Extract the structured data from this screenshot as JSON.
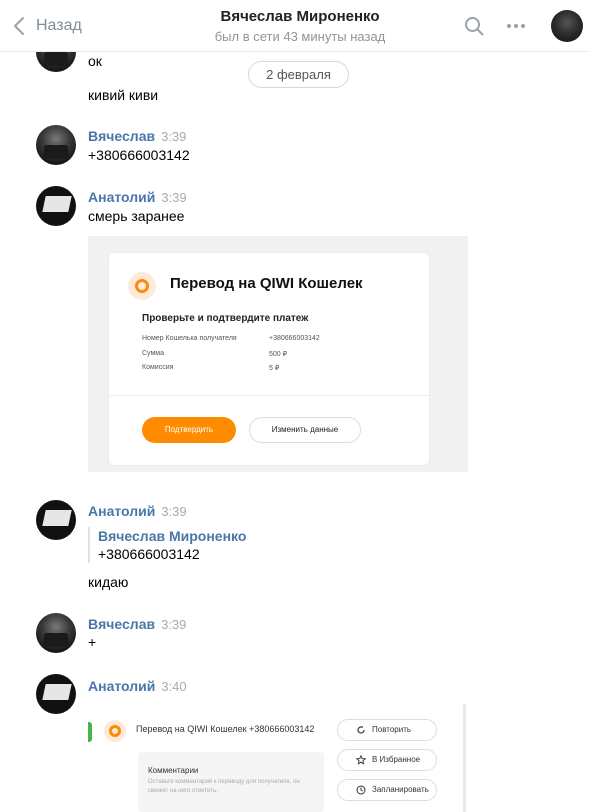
{
  "header": {
    "back_label": "Назад",
    "title": "Вячеслав Мироненко",
    "subtitle": "был в сети 43 минуты назад",
    "icons": [
      "chevron-left-icon",
      "search-icon",
      "more-icon"
    ]
  },
  "date_divider": "2 февраля",
  "messages": [
    {
      "text": "ок"
    },
    {
      "text": "кивий киви"
    },
    {
      "author": "Вячеслав",
      "time": "3:39",
      "text": "+380666003142"
    },
    {
      "author": "Анатолий",
      "time": "3:39",
      "text": "смерь заранее"
    },
    {
      "author": "Анатолий",
      "time": "3:39",
      "fwd_author": "Вячеслав Мироненко",
      "fwd_text": "+380666003142",
      "text": "кидаю"
    },
    {
      "author": "Вячеслав",
      "time": "3:39",
      "text": "+"
    },
    {
      "author": "Анатолий",
      "time": "3:40"
    }
  ],
  "qiwi_card": {
    "title": "Перевод на QIWI Кошелек",
    "subtitle": "Проверьте и подтвердите платеж",
    "rows": [
      {
        "label": "Номер Кошелька получателя",
        "value": "+380666003142"
      },
      {
        "label": "Сумма",
        "value": "500 ₽"
      },
      {
        "label": "Комиссия",
        "value": "5 ₽"
      }
    ],
    "confirm_label": "Подтвердить",
    "change_label": "Изменить данные",
    "accent": "#ff8c00"
  },
  "qiwi_shot": {
    "title": "Перевод на QIWI Кошелек +380666003142",
    "buttons": [
      "Повторить",
      "В Избранное",
      "Запланировать"
    ],
    "comment_title": "Комментарии",
    "comment_hint": "Оставьте комментарий к переводу для получателя, он сможет на него ответить."
  }
}
